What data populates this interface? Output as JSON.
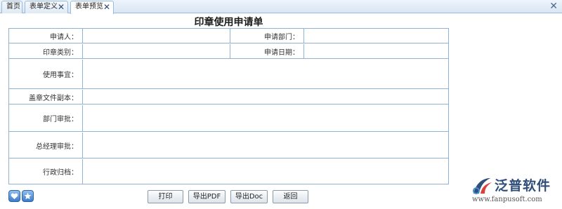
{
  "tabs": [
    {
      "label": "首页",
      "closable": false,
      "active": false
    },
    {
      "label": "表单定义",
      "closable": true,
      "active": false
    },
    {
      "label": "表单预览",
      "closable": true,
      "active": true
    }
  ],
  "window": {
    "close_glyph": "✕"
  },
  "form": {
    "title": "印章使用申请单",
    "fields": {
      "applicant": "申请人：",
      "department": "申请部门：",
      "seal_type": "印章类别：",
      "apply_date": "申请日期：",
      "usage_matter": "使用事宜：",
      "stamped_copy": "盖章文件副本：",
      "dept_approval": "部门审批：",
      "gm_approval": "总经理审批：",
      "admin_archive": "行政归档："
    }
  },
  "buttons": {
    "print": "打印",
    "export_pdf": "导出PDF",
    "export_doc": "导出Doc",
    "back": "返回"
  },
  "icons": [
    "heart-icon",
    "star-icon"
  ],
  "logo": {
    "name": "泛普软件",
    "url": "www.fanpusoft.com",
    "color": "#2f4f7a"
  }
}
